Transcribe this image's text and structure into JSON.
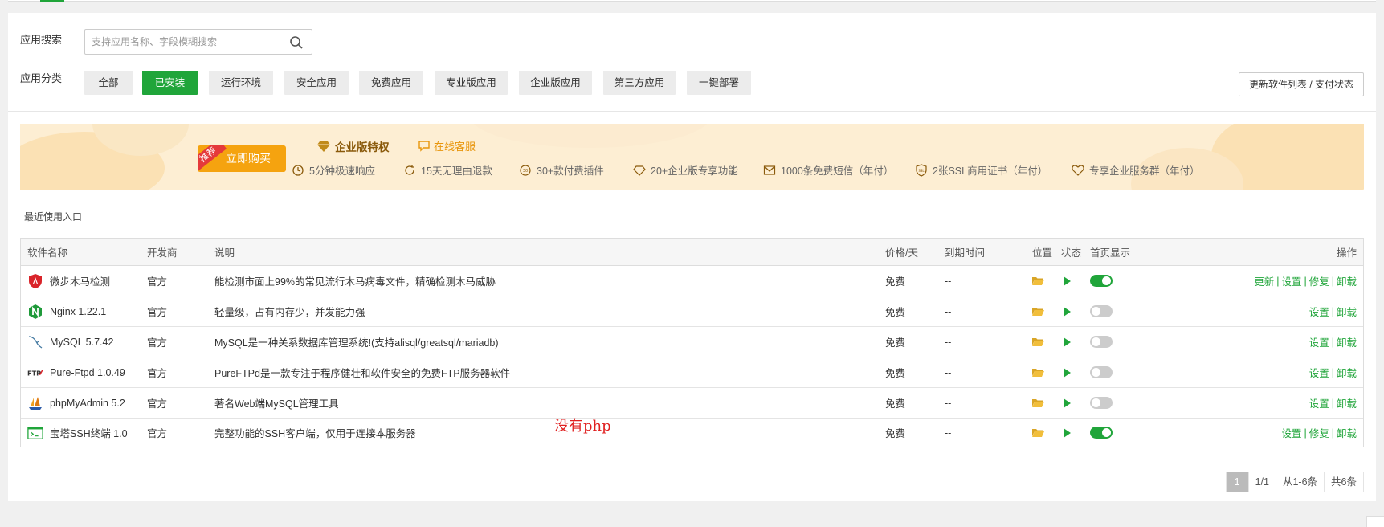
{
  "search": {
    "label": "应用搜索",
    "placeholder": "支持应用名称、字段模糊搜索"
  },
  "category": {
    "label": "应用分类",
    "items": [
      "全部",
      "已安装",
      "运行环境",
      "安全应用",
      "免费应用",
      "专业版应用",
      "企业版应用",
      "第三方应用",
      "一键部署"
    ],
    "active_index": 1,
    "update_button": "更新软件列表 / 支付状态"
  },
  "banner": {
    "tag": "推荐",
    "buy": "立即购买",
    "title": "企业版特权",
    "service": "在线客服",
    "features": [
      "5分钟极速响应",
      "15天无理由退款",
      "30+款付费插件",
      "20+企业版专享功能",
      "1000条免费短信（年付）",
      "2张SSL商用证书（年付）",
      "专享企业服务群（年付）"
    ]
  },
  "recent_label": "最近使用入口",
  "table": {
    "headers": {
      "name": "软件名称",
      "vendor": "开发商",
      "desc": "说明",
      "price": "价格/天",
      "expire": "到期时间",
      "location": "位置",
      "status": "状态",
      "homepage": "首页显示",
      "ops": "操作"
    },
    "rows": [
      {
        "name": "微步木马检测",
        "vendor": "官方",
        "desc": "能检测市面上99%的常见流行木马病毒文件，精确检测木马威胁",
        "price": "免费",
        "expire": "--",
        "homepage_on": true,
        "ops": [
          "更新",
          "设置",
          "修复",
          "卸载"
        ],
        "icon": "shield-icon"
      },
      {
        "name": "Nginx 1.22.1",
        "vendor": "官方",
        "desc": "轻量级，占有内存少，并发能力强",
        "price": "免费",
        "expire": "--",
        "homepage_on": false,
        "ops": [
          "设置",
          "卸载"
        ],
        "icon": "nginx-icon"
      },
      {
        "name": "MySQL 5.7.42",
        "vendor": "官方",
        "desc": "MySQL是一种关系数据库管理系统!(支持alisql/greatsql/mariadb)",
        "price": "免费",
        "expire": "--",
        "homepage_on": false,
        "ops": [
          "设置",
          "卸载"
        ],
        "icon": "mysql-dolphin-icon"
      },
      {
        "name": "Pure-Ftpd 1.0.49",
        "vendor": "官方",
        "desc": "PureFTPd是一款专注于程序健壮和软件安全的免费FTP服务器软件",
        "price": "免费",
        "expire": "--",
        "homepage_on": false,
        "ops": [
          "设置",
          "卸载"
        ],
        "icon": "ftp-icon"
      },
      {
        "name": "phpMyAdmin 5.2",
        "vendor": "官方",
        "desc": "著名Web端MySQL管理工具",
        "price": "免费",
        "expire": "--",
        "homepage_on": false,
        "ops": [
          "设置",
          "卸载"
        ],
        "icon": "sailboat-icon"
      },
      {
        "name": "宝塔SSH终端 1.0",
        "vendor": "官方",
        "desc": "完整功能的SSH客户端，仅用于连接本服务器",
        "price": "免费",
        "expire": "--",
        "homepage_on": true,
        "ops": [
          "设置",
          "修复",
          "卸载"
        ],
        "icon": "terminal-icon"
      }
    ]
  },
  "annotation": "没有php",
  "pagination": {
    "current": "1",
    "pages": "1/1",
    "range": "从1-6条",
    "total": "共6条"
  },
  "colors": {
    "accent": "#20a53a",
    "buy": "#f5a30f",
    "tag": "#e5393a",
    "banner_bg": "#fdeed3",
    "annotation": "#e02020"
  }
}
